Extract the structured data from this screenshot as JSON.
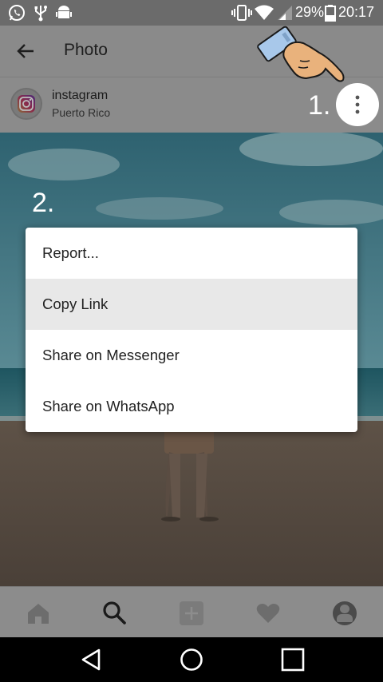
{
  "status_bar": {
    "battery": "29%",
    "time": "20:17",
    "icons": [
      "whatsapp-icon",
      "usb-icon",
      "android-icon",
      "vibrate-icon",
      "wifi-icon",
      "signal-icon",
      "battery-icon"
    ]
  },
  "app_bar": {
    "back_icon": "arrow-left-icon",
    "title": "Photo"
  },
  "post": {
    "username": "instagram",
    "location": "Puerto Rico",
    "more_icon": "more-vertical-icon"
  },
  "annotations": {
    "step1": "1.",
    "step2": "2."
  },
  "menu": {
    "items": [
      {
        "label": "Report..."
      },
      {
        "label": "Copy Link",
        "highlighted": true
      },
      {
        "label": "Share on Messenger"
      },
      {
        "label": "Share on WhatsApp"
      }
    ]
  },
  "bottom_nav": {
    "icons": [
      "home-icon",
      "search-icon",
      "add-icon",
      "heart-icon",
      "profile-icon"
    ],
    "active": "search-icon"
  },
  "system_nav": {
    "icons": [
      "back-triangle-icon",
      "home-circle-icon",
      "recents-square-icon"
    ]
  }
}
